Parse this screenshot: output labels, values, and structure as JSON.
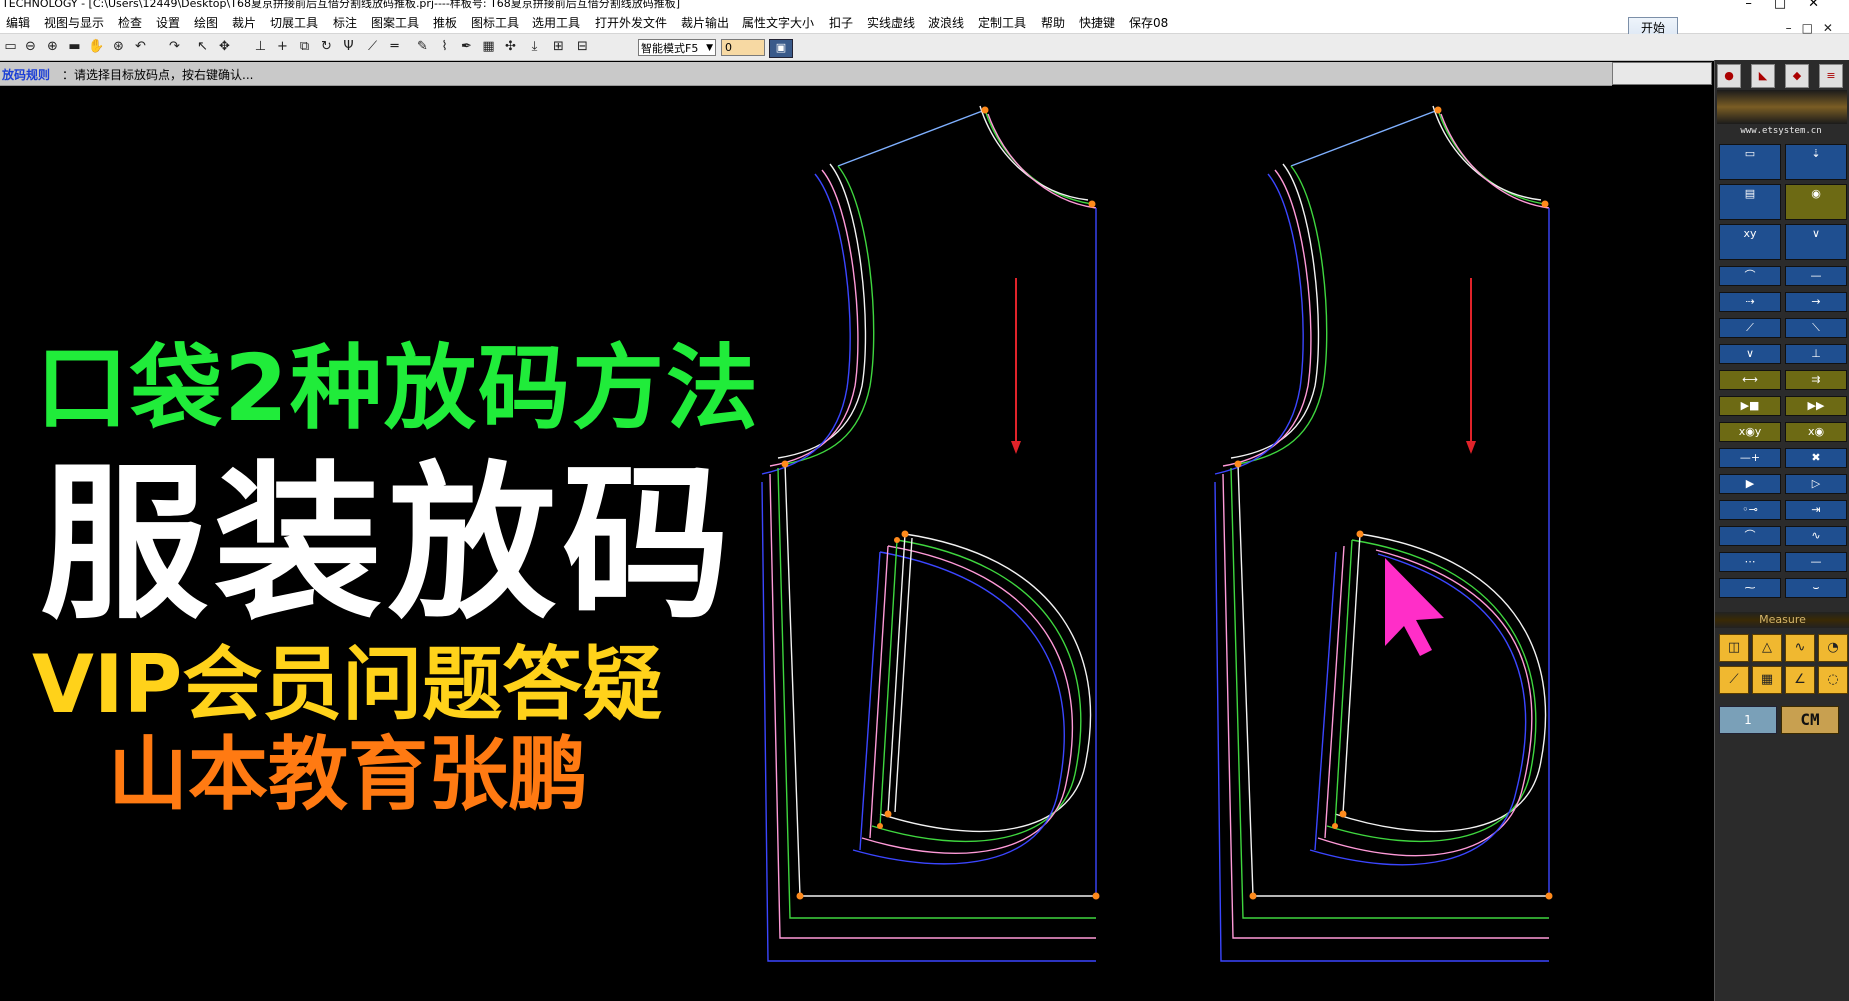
{
  "window": {
    "title": "TECHNOLOGY - [C:\\Users\\12449\\Desktop\\T68夏京拼接前后互借分割线放码推板.prj----样板号: T68夏京拼接前后互借分割线放码推板]"
  },
  "menu": {
    "items": [
      "编辑",
      "视图与显示",
      "检查",
      "设置",
      "绘图",
      "裁片",
      "切展工具",
      "标注",
      "图案工具",
      "推板",
      "图标工具",
      "选用工具",
      "打开外发文件",
      "裁片输出",
      "属性文字大小",
      "扣子",
      "实线虚线",
      "波浪线",
      "定制工具",
      "帮助",
      "快捷键",
      "保存08"
    ],
    "start_button": "开始"
  },
  "toolbar": {
    "mode_select": "智能模式F5",
    "number_field": "0",
    "icons": [
      "save-icon",
      "zoom-out-icon",
      "zoom-in-icon",
      "fill-icon",
      "pan-icon",
      "zoom-window-icon",
      "undo-icon",
      "redo-icon",
      "select-icon",
      "move-icon",
      "align-icon",
      "cross-icon",
      "mirror-icon",
      "rotate-icon",
      "fork-icon",
      "line-icon",
      "parallel-icon",
      "brush-icon",
      "curve-icon",
      "pen-icon",
      "color-icon",
      "point-icon",
      "node-icon",
      "grid-icon"
    ]
  },
  "status": {
    "label": "放码规则",
    "text": "：请选择目标放码点，按右键确认..."
  },
  "overlay": {
    "line1": "口袋2种放码方法",
    "line2": "服装放码",
    "line3": "VIP会员问题答疑",
    "line4": "山本教育张鹏"
  },
  "sidepanel": {
    "website": "www.etsystem.cn",
    "measure_label": "Measure",
    "unit_button": "CM",
    "layer_button": "1"
  },
  "colors": {
    "title_green": "#20ec3a",
    "title_white": "#ffffff",
    "title_yellow": "#ffd21a",
    "title_orange": "#ff7a12",
    "cursor_magenta": "#ff2ec8",
    "grade_blue": "#3b46ff",
    "grade_green": "#3fd63f",
    "grade_pink": "#ff9ad8",
    "grade_white": "#f2f2f2"
  }
}
